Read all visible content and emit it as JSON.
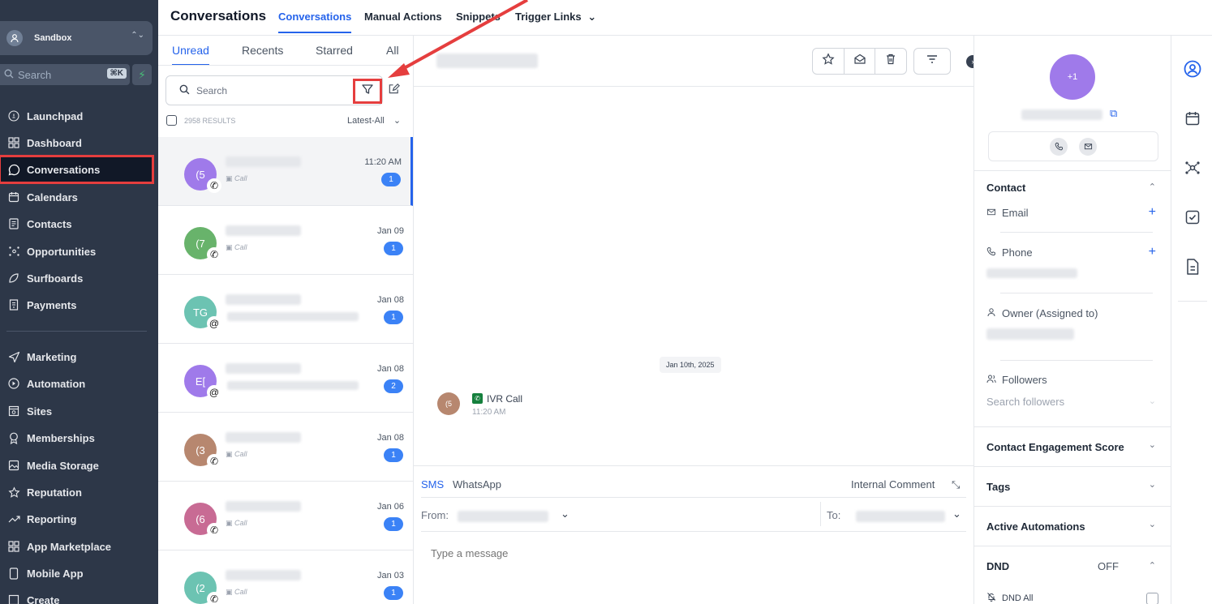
{
  "sidebar": {
    "account": {
      "initial": "🏪",
      "name": "Sandbox"
    },
    "search": {
      "placeholder": "Search",
      "shortcut": "⌘K"
    },
    "items": [
      {
        "label": "Launchpad",
        "icon": "rocket-icon"
      },
      {
        "label": "Dashboard",
        "icon": "grid-icon"
      },
      {
        "label": "Conversations",
        "icon": "chat-icon",
        "active": true
      },
      {
        "label": "Calendars",
        "icon": "calendar-icon"
      },
      {
        "label": "Contacts",
        "icon": "contacts-icon"
      },
      {
        "label": "Opportunities",
        "icon": "opportunities-icon"
      },
      {
        "label": "Surfboards",
        "icon": "surfboard-icon"
      },
      {
        "label": "Payments",
        "icon": "payments-icon"
      },
      {
        "label": "Marketing",
        "icon": "send-icon"
      },
      {
        "label": "Automation",
        "icon": "automation-icon"
      },
      {
        "label": "Sites",
        "icon": "sites-icon"
      },
      {
        "label": "Memberships",
        "icon": "award-icon"
      },
      {
        "label": "Media Storage",
        "icon": "image-icon"
      },
      {
        "label": "Reputation",
        "icon": "star-icon"
      },
      {
        "label": "Reporting",
        "icon": "trend-icon"
      },
      {
        "label": "App Marketplace",
        "icon": "apps-icon"
      },
      {
        "label": "Mobile App",
        "icon": "mobile-icon"
      },
      {
        "label": "Create",
        "icon": "create-icon"
      }
    ]
  },
  "header": {
    "title": "Conversations",
    "tabs": [
      "Conversations",
      "Manual Actions",
      "Snippets",
      "Trigger Links"
    ]
  },
  "list": {
    "tabs": [
      "Unread",
      "Recents",
      "Starred",
      "All"
    ],
    "search_placeholder": "Search",
    "results": "2958 RESULTS",
    "sort": "Latest-All",
    "items": [
      {
        "initials": "(5",
        "color": "#9f7aea",
        "channel": "Call",
        "date": "11:20 AM",
        "count": "1"
      },
      {
        "initials": "(7",
        "color": "#68b36b",
        "channel": "Call",
        "date": "Jan 09",
        "count": "1"
      },
      {
        "initials": "TG",
        "color": "#6cc3b2",
        "channel": "",
        "date": "Jan 08",
        "count": "1"
      },
      {
        "initials": "E[",
        "color": "#9f7aea",
        "channel": "",
        "date": "Jan 08",
        "count": "2"
      },
      {
        "initials": "(3",
        "color": "#b7876f",
        "channel": "Call",
        "date": "Jan 08",
        "count": "1"
      },
      {
        "initials": "(6",
        "color": "#c86b94",
        "channel": "Call",
        "date": "Jan 06",
        "count": "1"
      },
      {
        "initials": "(2",
        "color": "#6cc3b2",
        "channel": "Call",
        "date": "Jan 03",
        "count": "1"
      }
    ]
  },
  "thread": {
    "date_divider": "Jan 10th, 2025",
    "message": {
      "initials": "(5",
      "type": "IVR Call",
      "time": "11:20 AM"
    }
  },
  "composer": {
    "tabs": [
      "SMS",
      "WhatsApp"
    ],
    "internal_comment": "Internal Comment",
    "from_label": "From:",
    "to_label": "To:",
    "placeholder": "Type a message"
  },
  "contact_panel": {
    "avatar": "+1",
    "sections": {
      "contact": "Contact",
      "email": "Email",
      "phone": "Phone",
      "owner": "Owner (Assigned to)",
      "followers": "Followers",
      "followers_placeholder": "Search followers",
      "engagement": "Contact Engagement Score",
      "tags": "Tags",
      "automations": "Active Automations",
      "dnd": "DND",
      "dnd_state": "OFF",
      "dnd_all": "DND All"
    }
  },
  "colors": {
    "accent": "#2563eb",
    "sidebar": "#2d3748",
    "highlight": "#e53e3e"
  }
}
